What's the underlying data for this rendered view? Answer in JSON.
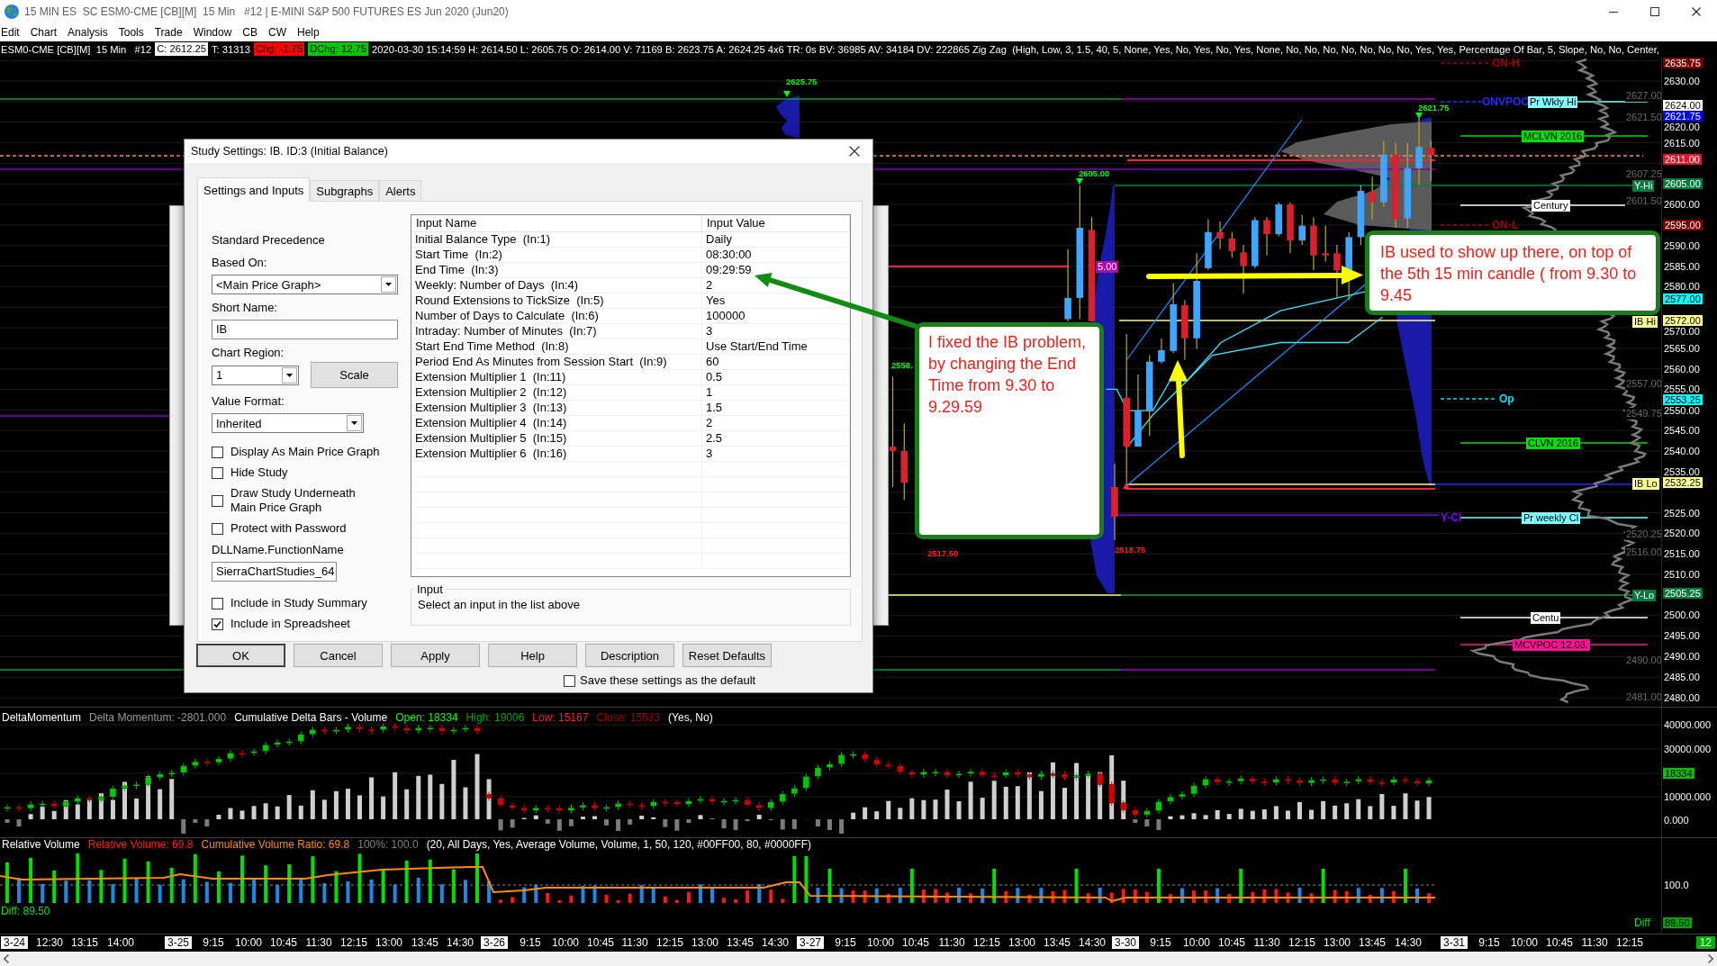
{
  "window": {
    "title": "15 MIN ES  SC ESM0-CME [CB][M]  15 Min   #12 | E-MINI S&P 500 FUTURES ES Jun 2020 (Jun20)"
  },
  "menu": [
    "Edit",
    "Chart",
    "Analysis",
    "Tools",
    "Trade",
    "Window",
    "CB",
    "CW",
    "Help"
  ],
  "info_line": [
    {
      "text": "ESM0-CME [CB][M]  15 Min   #12"
    },
    {
      "text": "C: 2612.25",
      "color": "#ffffff"
    },
    {
      "text": "T: 31313"
    },
    {
      "text": "Chg: -1.75",
      "color": "#ff0000"
    },
    {
      "text": "DChg: 12.75",
      "color": "#00c800"
    },
    {
      "text": "2020-03-30 15:14:59 H: 2614.50 L: 2605.75 O: 2614.00 V: 71169 B: 2623.75 A: 2624.25 4x6 TR: 0s BV: 36985 AV: 34184 DV: 222865 Zig Zag  (High, Low, 3, 1.5, 40, 5, None, Yes, No, Yes, No, Yes, None, No, No, No, No, No, No, No, Yes, Yes, Percentage Of Bar, 5, Slope, No, No, Center,"
    }
  ],
  "main_chart": {
    "price_axis": [
      {
        "value": "2635.75",
        "color": "#7a0000"
      },
      {
        "value": "2630.00"
      },
      {
        "value": "2624.00",
        "color": "#ffffff"
      },
      {
        "value": "2621.75",
        "color": "#0000ff"
      },
      {
        "value": "2620.00"
      },
      {
        "value": "2615.00"
      },
      {
        "value": "2611.00",
        "color": "#e8102a"
      },
      {
        "value": "2605.00",
        "color": "#007a3d"
      },
      {
        "value": "2600.00"
      },
      {
        "value": "2595.00",
        "color": "#7a0000"
      },
      {
        "value": "2590.00"
      },
      {
        "value": "2585.00"
      },
      {
        "value": "2580.00"
      },
      {
        "value": "2577.00",
        "color": "#00ffff"
      },
      {
        "value": "2572.00",
        "color": "#ffff99"
      },
      {
        "value": "2570.00"
      },
      {
        "value": "2565.00"
      },
      {
        "value": "2560.00"
      },
      {
        "value": "2555.00"
      },
      {
        "value": "2553.25",
        "color": "#00ffff"
      },
      {
        "value": "2550.00"
      },
      {
        "value": "2545.00"
      },
      {
        "value": "2540.00"
      },
      {
        "value": "2535.00"
      },
      {
        "value": "2532.25",
        "color": "#ffff99"
      },
      {
        "value": "2525.00"
      },
      {
        "value": "2520.00"
      },
      {
        "value": "2515.00"
      },
      {
        "value": "2510.00"
      },
      {
        "value": "2505.25",
        "color": "#007a3d"
      },
      {
        "value": "2500.00"
      },
      {
        "value": "2495.00"
      },
      {
        "value": "2490.00"
      },
      {
        "value": "2485.00"
      },
      {
        "value": "2480.00"
      }
    ],
    "level_labels": [
      {
        "text": "ON-H",
        "kind": "plain",
        "color": "#a00000"
      },
      {
        "text": "ONVPOC",
        "kind": "plain",
        "color": "#2828ff"
      },
      {
        "text": "Pr Wkly Hi",
        "kind": "boxed",
        "color": "#80ffff"
      },
      {
        "text": "MCLVN 2016",
        "kind": "boxed",
        "color": "#00dd00"
      },
      {
        "text": "Century",
        "kind": "boxed",
        "color": "#ffffff"
      },
      {
        "text": "ON-L",
        "kind": "plain",
        "color": "#a00000"
      },
      {
        "text": "5.00",
        "kind": "boxed",
        "color": "#b000b0"
      },
      {
        "text": "Op",
        "kind": "plain",
        "color": "#00e0ff"
      },
      {
        "text": "CLVN 2016",
        "kind": "boxed",
        "color": "#00dd00"
      },
      {
        "text": "Y-Cl",
        "kind": "plain",
        "color": "#8000ff"
      },
      {
        "text": "Pr weekly Cl",
        "kind": "boxed",
        "color": "#80ffff"
      },
      {
        "text": "Centu",
        "kind": "boxed",
        "color": "#ffffff"
      },
      {
        "text": "MCVPOC 12.03.",
        "kind": "boxed",
        "color": "#ff1493"
      },
      {
        "text": "Y-Hi",
        "kind": "boxed",
        "color": "#007a3d"
      },
      {
        "text": "IB Hi",
        "kind": "boxed",
        "color": "#ffff99"
      },
      {
        "text": "IB Lo",
        "kind": "boxed",
        "color": "#ffff99"
      },
      {
        "text": "Y-Lo",
        "kind": "boxed",
        "color": "#007a3d"
      }
    ],
    "swing_labels": [
      {
        "text": "2625.75",
        "color": "#00ff00"
      },
      {
        "text": "2605.00",
        "color": "#00ff00"
      },
      {
        "text": "2621.75",
        "color": "#00ff00"
      },
      {
        "text": "2558.",
        "color": "#00ff00"
      },
      {
        "text": "2517.50",
        "color": "#ff2020"
      },
      {
        "text": "2518.75",
        "color": "#ff2020"
      }
    ],
    "zigzag_labels": [
      "2627.00",
      "2621.50",
      "2607.25",
      "2601.50",
      "2557.00",
      "2549.75",
      "2520.25",
      "2516.00",
      "2490.00",
      "2481.00"
    ]
  },
  "callouts": [
    {
      "text": "I fixed the IB problem, by changing the End Time from 9.30 to 9.29.59"
    },
    {
      "text": "IB used to show up there, on top of the 5th 15 min candle ( from 9.30 to 9.45"
    }
  ],
  "dialog": {
    "title": "Study Settings: IB. ID:3 (Initial Balance)",
    "tabs": [
      {
        "label": "Settings and Inputs",
        "selected": true
      },
      {
        "label": "Subgraphs",
        "selected": false
      },
      {
        "label": "Alerts",
        "selected": false
      }
    ],
    "left_panel": [
      {
        "kind": "text",
        "text": "Standard Precedence"
      },
      {
        "kind": "label",
        "text": "Based On:"
      },
      {
        "kind": "dropdown",
        "value": "<Main Price Graph>"
      },
      {
        "kind": "label",
        "text": "Short Name:"
      },
      {
        "kind": "input",
        "value": "IB"
      },
      {
        "kind": "label",
        "text": "Chart Region:"
      },
      {
        "kind": "dropdown",
        "value": "1",
        "button": "Scale"
      },
      {
        "kind": "label",
        "text": "Value Format:"
      },
      {
        "kind": "dropdown",
        "value": "Inherited"
      },
      {
        "kind": "checkbox",
        "label": "Display As Main Price Graph",
        "checked": false
      },
      {
        "kind": "checkbox",
        "label": "Hide Study",
        "checked": false
      },
      {
        "kind": "checkbox",
        "label": "Draw Study Underneath Main Price Graph",
        "checked": false
      },
      {
        "kind": "checkbox",
        "label": "Protect with Password",
        "checked": false
      },
      {
        "kind": "label",
        "text": "DLLName.FunctionName"
      },
      {
        "kind": "input",
        "value": "SierraChartStudies_64"
      },
      {
        "kind": "checkbox",
        "label": "Include in Study Summary",
        "checked": false
      },
      {
        "kind": "checkbox",
        "label": "Include in Spreadsheet",
        "checked": true
      }
    ],
    "table": {
      "columns": [
        "Input Name",
        "Input Value"
      ],
      "rows": [
        [
          "Initial Balance Type  (In:1)",
          "Daily"
        ],
        [
          "Start Time  (In:2)",
          "08:30:00"
        ],
        [
          "End Time  (In:3)",
          "09:29:59"
        ],
        [
          "Weekly: Number of Days  (In:4)",
          "2"
        ],
        [
          "Round Extensions to TickSize  (In:5)",
          "Yes"
        ],
        [
          "Number of Days to Calculate  (In:6)",
          "100000"
        ],
        [
          "Intraday: Number of Minutes  (In:7)",
          "3"
        ],
        [
          "Start End Time Method  (In:8)",
          "Use Start/End Time"
        ],
        [
          "Period End As Minutes from Session Start  (In:9)",
          "60"
        ],
        [
          "Extension Multiplier 1  (In:11)",
          "0.5"
        ],
        [
          "Extension Multiplier 2  (In:12)",
          "1"
        ],
        [
          "Extension Multiplier 3  (In:13)",
          "1.5"
        ],
        [
          "Extension Multiplier 4  (In:14)",
          "2"
        ],
        [
          "Extension Multiplier 5  (In:15)",
          "2.5"
        ],
        [
          "Extension Multiplier 6  (In:16)",
          "3"
        ]
      ]
    },
    "input_group": {
      "title": "Input",
      "text": "Select an input in the list above"
    },
    "buttons": [
      {
        "label": "OK",
        "default": true
      },
      {
        "label": "Cancel",
        "default": false
      },
      {
        "label": "Apply",
        "default": false
      },
      {
        "label": "Help",
        "default": false
      },
      {
        "label": "Description",
        "default": false
      },
      {
        "label": "Reset Defaults",
        "default": false
      }
    ],
    "save_default": {
      "label": "Save these settings as the default",
      "checked": false
    }
  },
  "delta_pane": {
    "header": [
      {
        "text": "DeltaMomentum",
        "color": "#ffffff"
      },
      {
        "text": "Delta Momentum: -2801.000",
        "color": "#9a9a9a"
      },
      {
        "text": "Cumulative Delta Bars - Volume",
        "color": "#ffffff"
      },
      {
        "text": "Open: 18334",
        "color": "#00ff00"
      },
      {
        "text": "High: 19006",
        "color": "#00a000"
      },
      {
        "text": "Low: 15167",
        "color": "#ff2020"
      },
      {
        "text": "Close: 15533",
        "color": "#a00000"
      },
      {
        "text": "(Yes, No)",
        "color": "#ffffff"
      }
    ],
    "axis": [
      {
        "value": "40000.000"
      },
      {
        "value": "30000.000"
      },
      {
        "value": "18334",
        "color": "#00c000"
      },
      {
        "value": "10000.000"
      },
      {
        "value": "0.000"
      }
    ]
  },
  "volume_pane": {
    "header": [
      {
        "text": "Relative Volume",
        "color": "#ffffff"
      },
      {
        "text": "Relative Volume: 69.8",
        "color": "#ff2020"
      },
      {
        "text": "Cumulative Volume Ratio: 69.8",
        "color": "#ff8c00"
      },
      {
        "text": "100%: 100.0",
        "color": "#808080"
      },
      {
        "text": "(20, All Days, Yes, Average Volume, Volume, 1, 50, 120, #00FF00, 80, #0000FF)",
        "color": "#ffffff"
      }
    ],
    "diff": "Diff: 89.50",
    "axis_caption": "Diff",
    "axis": [
      {
        "value": "100.0"
      },
      {
        "value": "89.50",
        "color": "#00a000"
      }
    ]
  },
  "time_axis": {
    "labels": [
      {
        "text": "3-24",
        "kind": "date"
      },
      {
        "text": "12:30",
        "kind": "time"
      },
      {
        "text": "13:15",
        "kind": "time"
      },
      {
        "text": "14:00",
        "kind": "time"
      },
      {
        "text": "3-25",
        "kind": "date"
      },
      {
        "text": "9:15",
        "kind": "time"
      },
      {
        "text": "10:00",
        "kind": "time"
      },
      {
        "text": "10:45",
        "kind": "time"
      },
      {
        "text": "11:30",
        "kind": "time"
      },
      {
        "text": "12:15",
        "kind": "time"
      },
      {
        "text": "13:00",
        "kind": "time"
      },
      {
        "text": "13:45",
        "kind": "time"
      },
      {
        "text": "14:30",
        "kind": "time"
      },
      {
        "text": "3-26",
        "kind": "date"
      },
      {
        "text": "9:15",
        "kind": "time"
      },
      {
        "text": "10:00",
        "kind": "time"
      },
      {
        "text": "10:45",
        "kind": "time"
      },
      {
        "text": "11:30",
        "kind": "time"
      },
      {
        "text": "12:15",
        "kind": "time"
      },
      {
        "text": "13:00",
        "kind": "time"
      },
      {
        "text": "13:45",
        "kind": "time"
      },
      {
        "text": "14:30",
        "kind": "time"
      },
      {
        "text": "3-27",
        "kind": "date"
      },
      {
        "text": "9:15",
        "kind": "time"
      },
      {
        "text": "10:00",
        "kind": "time"
      },
      {
        "text": "10:45",
        "kind": "time"
      },
      {
        "text": "11:30",
        "kind": "time"
      },
      {
        "text": "12:15",
        "kind": "time"
      },
      {
        "text": "13:00",
        "kind": "time"
      },
      {
        "text": "13:45",
        "kind": "time"
      },
      {
        "text": "14:30",
        "kind": "time"
      },
      {
        "text": "3-30",
        "kind": "date"
      },
      {
        "text": "9:15",
        "kind": "time"
      },
      {
        "text": "10:00",
        "kind": "time"
      },
      {
        "text": "10:45",
        "kind": "time"
      },
      {
        "text": "11:30",
        "kind": "time"
      },
      {
        "text": "12:15",
        "kind": "time"
      },
      {
        "text": "13:00",
        "kind": "time"
      },
      {
        "text": "13:45",
        "kind": "time"
      },
      {
        "text": "14:30",
        "kind": "time"
      },
      {
        "text": "3-31",
        "kind": "date"
      },
      {
        "text": "9:15",
        "kind": "time"
      },
      {
        "text": "10:00",
        "kind": "time"
      },
      {
        "text": "10:45",
        "kind": "time"
      },
      {
        "text": "11:30",
        "kind": "time"
      },
      {
        "text": "12:15",
        "kind": "time"
      }
    ],
    "badge": "12"
  }
}
